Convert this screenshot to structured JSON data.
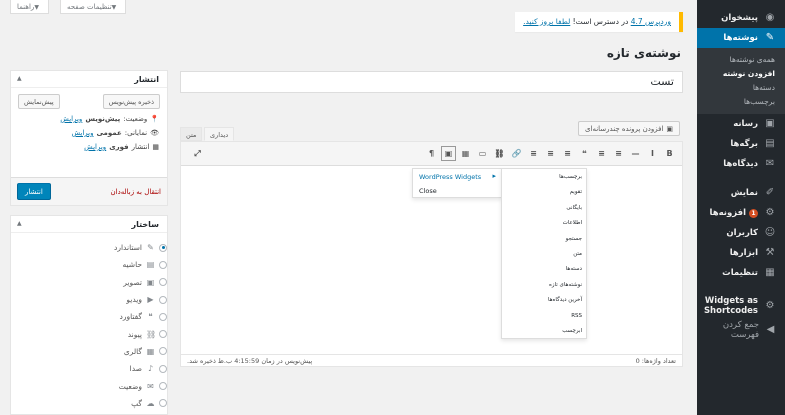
{
  "screen_meta": {
    "options_label": "تنظیمات صفحه",
    "help_label": "راهنما"
  },
  "sidebar": {
    "items": [
      {
        "label": "پیشخوان",
        "icon": "dashboard-icon",
        "glyph": "◉"
      },
      {
        "label": "نوشته‌ها",
        "icon": "pushpin-icon",
        "glyph": "✎",
        "current": true
      },
      {
        "label": "رسانه",
        "icon": "media-icon",
        "glyph": "▣"
      },
      {
        "label": "برگه‌ها",
        "icon": "pages-icon",
        "glyph": "▤"
      },
      {
        "label": "دیدگاه‌ها",
        "icon": "comments-icon",
        "glyph": "✉"
      },
      {
        "label": "نمایش",
        "icon": "appearance-icon",
        "glyph": "✐"
      },
      {
        "label": "افزونه‌ها",
        "icon": "plugins-icon",
        "glyph": "⚙",
        "badge": "1"
      },
      {
        "label": "کاربران",
        "icon": "users-icon",
        "glyph": "☺"
      },
      {
        "label": "ابزارها",
        "icon": "tools-icon",
        "glyph": "⚒"
      },
      {
        "label": "تنظیمات",
        "icon": "settings-icon",
        "glyph": "▦"
      },
      {
        "label": "Widgets as Shortcodes",
        "icon": "gear-icon",
        "glyph": "⚙"
      },
      {
        "label": "جمع کردن فهرست",
        "icon": "collapse-icon",
        "glyph": "◀"
      }
    ],
    "submenu": [
      "همه‌ی نوشته‌ها",
      "افزودن نوشته",
      "دسته‌ها",
      "برچسب‌ها"
    ]
  },
  "update_nag": {
    "version_link": "وردپرس 4.7",
    "text": " در دسترس است! ",
    "update_link": "لطفا بروز کنید."
  },
  "page_title": "نوشته‌ی تازه",
  "post_title": "تست",
  "editor": {
    "add_media": "افزودن پرونده چندرسانه‌ای",
    "tab_visual": "دیداری",
    "tab_text": "متن",
    "toolbar": [
      "B",
      "I",
      "—",
      "≡",
      "≡",
      "❝",
      "≡",
      "≡",
      "≡",
      "🔗",
      "⛓",
      "▭",
      "▦",
      "▣",
      "¶"
    ],
    "word_count": "تعداد واژه‌ها: 0",
    "autosave": "پیش‌نویس در زمان 4:15:59 ب.ظ ذخیره شد."
  },
  "dropdown": {
    "main": [
      "WordPress Widgets",
      "Close"
    ],
    "sub": [
      "برچسب‌ها",
      "تقویم",
      "بایگانی",
      "اطلاعات",
      "جستجو",
      "متن",
      "دسته‌ها",
      "نوشته‌های تازه",
      "آخرین دیدگاه‌ها",
      "RSS",
      "ابرچسب"
    ]
  },
  "publish": {
    "title": "انتشار",
    "save_draft": "ذخیره پیش‌نویس",
    "preview": "پیش‌نمایش",
    "status_label": "وضعیت:",
    "status_value": "پیش‌نویس",
    "visibility_label": "نمایانی:",
    "visibility_value": "عمومی",
    "schedule_label": "انتشار",
    "schedule_value": "فوری",
    "edit": "ویرایش",
    "trash": "انتقال به زباله‌دان",
    "publish_btn": "انتشار"
  },
  "format": {
    "title": "ساختار",
    "options": [
      {
        "label": "استاندارد",
        "icon": "pin-icon",
        "glyph": "✎",
        "checked": true
      },
      {
        "label": "حاشیه",
        "icon": "aside-icon",
        "glyph": "▤"
      },
      {
        "label": "تصویر",
        "icon": "image-icon",
        "glyph": "▣"
      },
      {
        "label": "ویدیو",
        "icon": "video-icon",
        "glyph": "▶"
      },
      {
        "label": "گفتاورد",
        "icon": "quote-icon",
        "glyph": "❝"
      },
      {
        "label": "پیوند",
        "icon": "link-icon",
        "glyph": "⛓"
      },
      {
        "label": "گالری",
        "icon": "gallery-icon",
        "glyph": "▦"
      },
      {
        "label": "صدا",
        "icon": "audio-icon",
        "glyph": "♪"
      },
      {
        "label": "وضعیت",
        "icon": "status-icon",
        "glyph": "✉"
      },
      {
        "label": "گپ",
        "icon": "chat-icon",
        "glyph": "☁"
      }
    ]
  }
}
